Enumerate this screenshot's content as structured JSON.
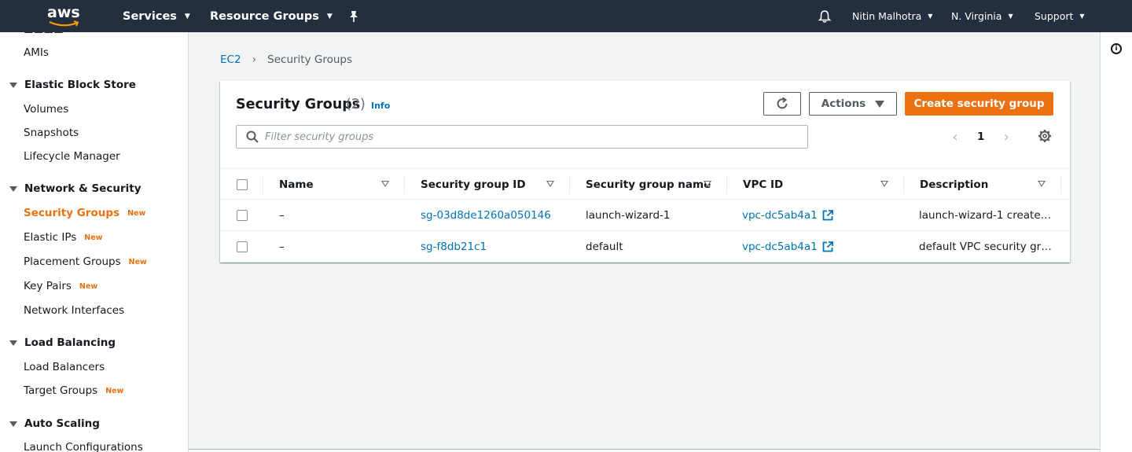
{
  "nav": {
    "logo_text": "aws",
    "services": "Services",
    "resource_groups": "Resource Groups",
    "user": "Nitin Malhotra",
    "region": "N. Virginia",
    "support": "Support"
  },
  "sidebar": {
    "amis": "AMIs",
    "ebs": {
      "title": "Elastic Block Store",
      "items": [
        "Volumes",
        "Snapshots",
        "Lifecycle Manager"
      ]
    },
    "network": {
      "title": "Network & Security",
      "items": [
        {
          "label": "Security Groups",
          "badge": "New"
        },
        {
          "label": "Elastic IPs",
          "badge": "New"
        },
        {
          "label": "Placement Groups",
          "badge": "New"
        },
        {
          "label": "Key Pairs",
          "badge": "New"
        },
        {
          "label": "Network Interfaces",
          "badge": ""
        }
      ]
    },
    "lb": {
      "title": "Load Balancing",
      "items": [
        {
          "label": "Load Balancers",
          "badge": ""
        },
        {
          "label": "Target Groups",
          "badge": "New"
        }
      ]
    },
    "autoscaling": {
      "title": "Auto Scaling",
      "items": [
        "Launch Configurations"
      ]
    }
  },
  "breadcrumb": {
    "root": "EC2",
    "current": "Security Groups"
  },
  "panel": {
    "title": "Security Groups",
    "count": "(2)",
    "info": "Info",
    "actions_label": "Actions",
    "create_label": "Create security group",
    "filter_placeholder": "Filter security groups",
    "page": "1"
  },
  "table": {
    "columns": [
      "Name",
      "Security group ID",
      "Security group name",
      "VPC ID",
      "Description"
    ],
    "rows": [
      {
        "name": "–",
        "id": "sg-03d8de1260a050146",
        "group_name": "launch-wizard-1",
        "vpc": "vpc-dc5ab4a1",
        "description": "launch-wizard-1 create…"
      },
      {
        "name": "–",
        "id": "sg-f8db21c1",
        "group_name": "default",
        "vpc": "vpc-dc5ab4a1",
        "description": "default VPC security gr…"
      }
    ]
  },
  "colors": {
    "nav_bg": "#232f3e",
    "accent_orange": "#ec7211",
    "link_blue": "#0073bb"
  }
}
